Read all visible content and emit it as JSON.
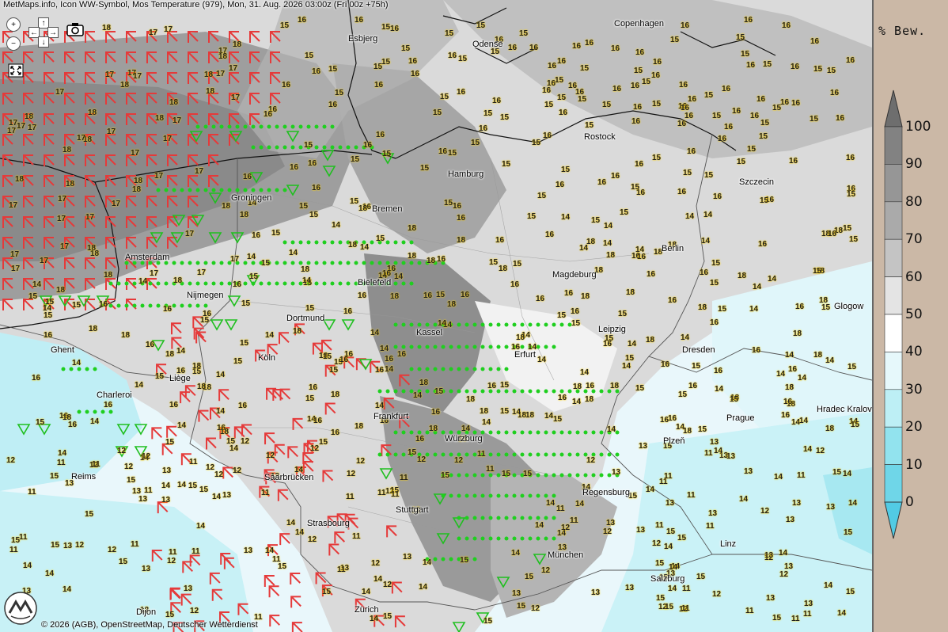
{
  "header": {
    "title": "MetMaps.info, Icon WW-Symbol, Mos Temperature (979), Mon, 31. Aug. 2026 03:00z (Fri 00z +75h)"
  },
  "footer": {
    "copyright": "© 2026 (AGB), OpenStreetMap, Deutscher Wetterdienst",
    "logo_text": "METMAPS"
  },
  "controls": {
    "zoom_in_icon": "zoom-in-icon",
    "zoom_out_icon": "zoom-out-icon",
    "pan_up": "↑",
    "pan_down": "↓",
    "pan_left": "←",
    "pan_right": "→",
    "camera_icon": "camera-icon",
    "fullscreen_icon": "fullscreen-icon"
  },
  "legend": {
    "unit": "% Bew.",
    "levels": [
      "100",
      "90",
      "80",
      "70",
      "60",
      "50",
      "40",
      "30",
      "20",
      "10",
      "0"
    ],
    "colors": [
      "#6e6e6e",
      "#828282",
      "#969696",
      "#aaaaaa",
      "#c4c4c4",
      "#e4e4e4",
      "#ffffff",
      "#e6f8fb",
      "#bdeff5",
      "#92e3ee",
      "#6fd6e8",
      "#52cbe4"
    ]
  },
  "cities": [
    {
      "name": "Esbjerg"
    },
    {
      "name": "Odense"
    },
    {
      "name": "Copenhagen"
    },
    {
      "name": "Rostock"
    },
    {
      "name": "Hamburg"
    },
    {
      "name": "Szczecin"
    },
    {
      "name": "Groningen"
    },
    {
      "name": "Bremen"
    },
    {
      "name": "Amsterdam"
    },
    {
      "name": "Berlin"
    },
    {
      "name": "Bielefeld"
    },
    {
      "name": "Magdeburg"
    },
    {
      "name": "Nijmegen"
    },
    {
      "name": "Glogow"
    },
    {
      "name": "Dortmund"
    },
    {
      "name": "Kassel"
    },
    {
      "name": "Leipzig"
    },
    {
      "name": "Ghent"
    },
    {
      "name": "Köln"
    },
    {
      "name": "Erfurt"
    },
    {
      "name": "Dresden"
    },
    {
      "name": "Liège"
    },
    {
      "name": "Charleroi"
    },
    {
      "name": "Frankfurt"
    },
    {
      "name": "Prague"
    },
    {
      "name": "Hradec Kralove"
    },
    {
      "name": "Würzburg"
    },
    {
      "name": "Plzeň"
    },
    {
      "name": "Reims"
    },
    {
      "name": "Saarbrücken"
    },
    {
      "name": "Regensburg"
    },
    {
      "name": "Stuttgart"
    },
    {
      "name": "Strasbourg"
    },
    {
      "name": "Linz"
    },
    {
      "name": "München"
    },
    {
      "name": "Salzburg"
    },
    {
      "name": "Dijon"
    },
    {
      "name": "Zürich"
    }
  ],
  "temperatures_sample": [
    "17",
    "18",
    "16",
    "15",
    "14",
    "13",
    "12",
    "11",
    "10",
    "9",
    "19"
  ]
}
